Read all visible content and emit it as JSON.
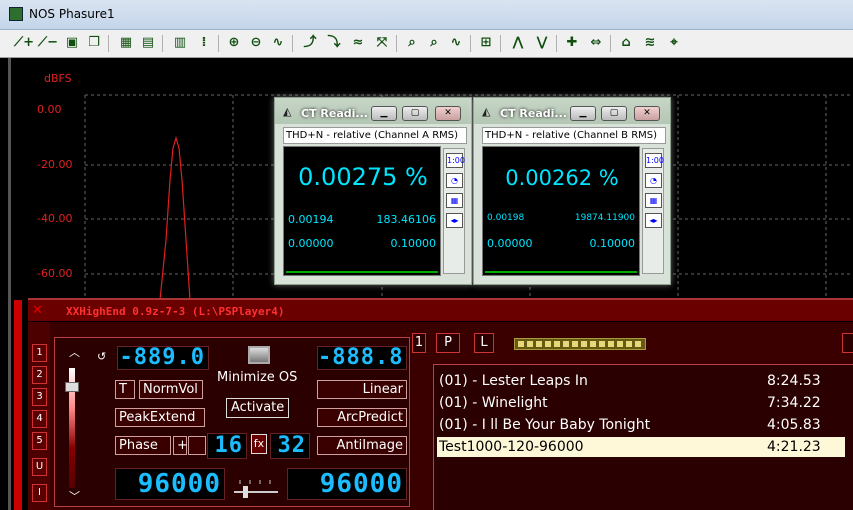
{
  "window": {
    "title": "NOS Phasure1",
    "icon": "app-icon"
  },
  "plot": {
    "ylabel": "dBFS",
    "yticks": [
      "0.00",
      "-20.00",
      "-40.00",
      "-60.00"
    ],
    "trace_color": "#e02020"
  },
  "readings": [
    {
      "title": "CT Readi...",
      "subtitle": "THD+N - relative (Channel A RMS)",
      "value": "0.00275 %",
      "left_value": "0.00194",
      "right_value": "183.46106",
      "scale_min": "0.00000",
      "scale_max": "0.10000",
      "side_label": "1:00"
    },
    {
      "title": "CT Readi...",
      "subtitle": "THD+N - relative (Channel B RMS)",
      "value": "0.00262 %",
      "left_value": "0.00198",
      "right_value": "19874.11900",
      "scale_min": "0.00000",
      "scale_max": "0.10000",
      "side_label": "1:00"
    }
  ],
  "player": {
    "title": "XXHighEnd 0.9z-7-3 (L:\\PSPlayer4)",
    "side_numbers": [
      "1",
      "2",
      "3",
      "4",
      "5",
      "U",
      "I"
    ],
    "lcd_volume": "-889.0",
    "lcd_right": "-888.8",
    "minimize_os": "Minimize OS",
    "activate": "Activate",
    "buttons": {
      "t": "T",
      "normvol": "NormVol",
      "peakextend": "PeakExtend",
      "phase": "Phase",
      "plus": "+",
      "linear": "Linear",
      "arcpredict": "ArcPredict",
      "antiimage": "AntiImage"
    },
    "fx": "fx",
    "lcd_bits_left": "16",
    "lcd_bits_right": "32",
    "lcd_rate_left": "96000",
    "lcd_rate_right": "96000",
    "header_buttons": [
      "1",
      "P",
      "L"
    ],
    "playlist": [
      {
        "title": "(01) - Lester Leaps In",
        "duration": "8:24.53",
        "selected": false
      },
      {
        "title": "(01) - Winelight",
        "duration": "7:34.22",
        "selected": false
      },
      {
        "title": "(01) - I ll Be Your Baby Tonight",
        "duration": "4:05.83",
        "selected": false
      },
      {
        "title": "Test1000-120-96000",
        "duration": "4:21.23",
        "selected": true
      }
    ]
  }
}
